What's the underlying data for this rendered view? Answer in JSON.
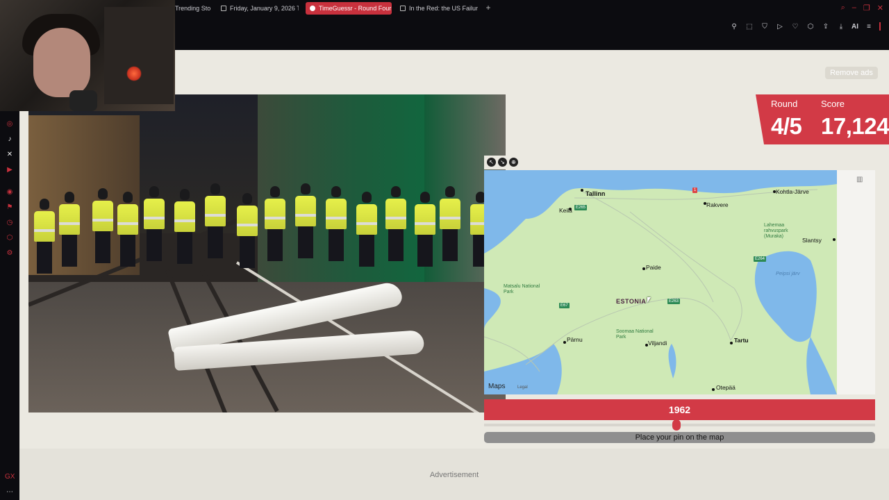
{
  "browser": {
    "tabs": [
      {
        "label": "Trending Sto"
      },
      {
        "label": "Friday, January 9, 2026 T"
      },
      {
        "label": "TimeGuessr - Round Four"
      },
      {
        "label": "In the Red: the US Failure"
      }
    ],
    "toolbar_ai_label": "AI"
  },
  "game": {
    "remove_ads": "Remove ads",
    "round_label": "Round",
    "round_value": "4/5",
    "score_label": "Score",
    "score_value": "17,124",
    "year_value": "1962",
    "guess_button": "Place your pin on the map"
  },
  "map": {
    "country": "ESTONIA",
    "cities": [
      "Tallinn",
      "Keila",
      "Rakvere",
      "Kohtla-Järve",
      "Slantsy",
      "Paide",
      "Pärnu",
      "Viljandi",
      "Tartu",
      "Otepää"
    ],
    "parks": [
      "Lahemaa rahvuspark (Muraka)",
      "Matsalu National Park",
      "Soomaa National Park"
    ],
    "water": "Peipsi järv",
    "road_shields": [
      "E265",
      "E264",
      "E67",
      "E263",
      "1"
    ],
    "attribution": "Maps",
    "legal": "Legal"
  },
  "footer": {
    "advertisement": "Advertisement"
  }
}
